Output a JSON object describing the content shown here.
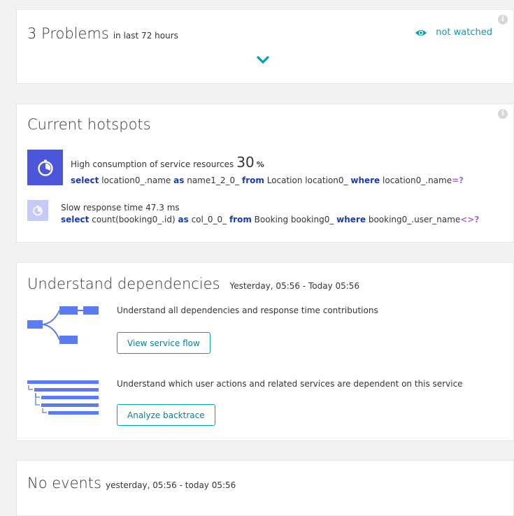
{
  "problems": {
    "count_title": "3 Problems",
    "range": "in last 72 hours",
    "watch_label": "not watched"
  },
  "hotspots": {
    "title": "Current hotspots",
    "items": [
      {
        "title": "High consumption of service resources",
        "value": "30",
        "unit": "%",
        "query": {
          "select_kw": "select",
          "field": "location0_.name",
          "as_kw": "as",
          "alias": "name1_2_0_",
          "from_kw": "from",
          "table": "Location location0_",
          "where_kw": "where",
          "cond": "location0_.name",
          "op": "=?"
        }
      },
      {
        "title": "Slow response time 47.3 ms",
        "query": {
          "select_kw": "select",
          "field": "count(booking0_.id)",
          "as_kw": "as",
          "alias": "col_0_0_",
          "from_kw": "from",
          "table": "Booking booking0_",
          "where_kw": "where",
          "cond": "booking0_.user_name",
          "op": "<>?"
        }
      }
    ]
  },
  "dependencies": {
    "title": "Understand dependencies",
    "range": "Yesterday, 05:56 - Today 05:56",
    "items": [
      {
        "text": "Understand all dependencies and response time contributions",
        "button": "View service flow",
        "icon": "service-flow-icon"
      },
      {
        "text": "Understand which user actions and related services are dependent on this service",
        "button": "Analyze backtrace",
        "icon": "backtrace-icon"
      }
    ]
  },
  "events": {
    "title": "No events",
    "range": "yesterday, 05:56 - today 05:56"
  },
  "colors": {
    "accent": "#00a1b2",
    "hotspot_primary": "#4c56d8",
    "hotspot_secondary": "#c5cbf6",
    "sql_keyword": "#1a3bb4",
    "graph_blue": "#5b7bf0"
  }
}
